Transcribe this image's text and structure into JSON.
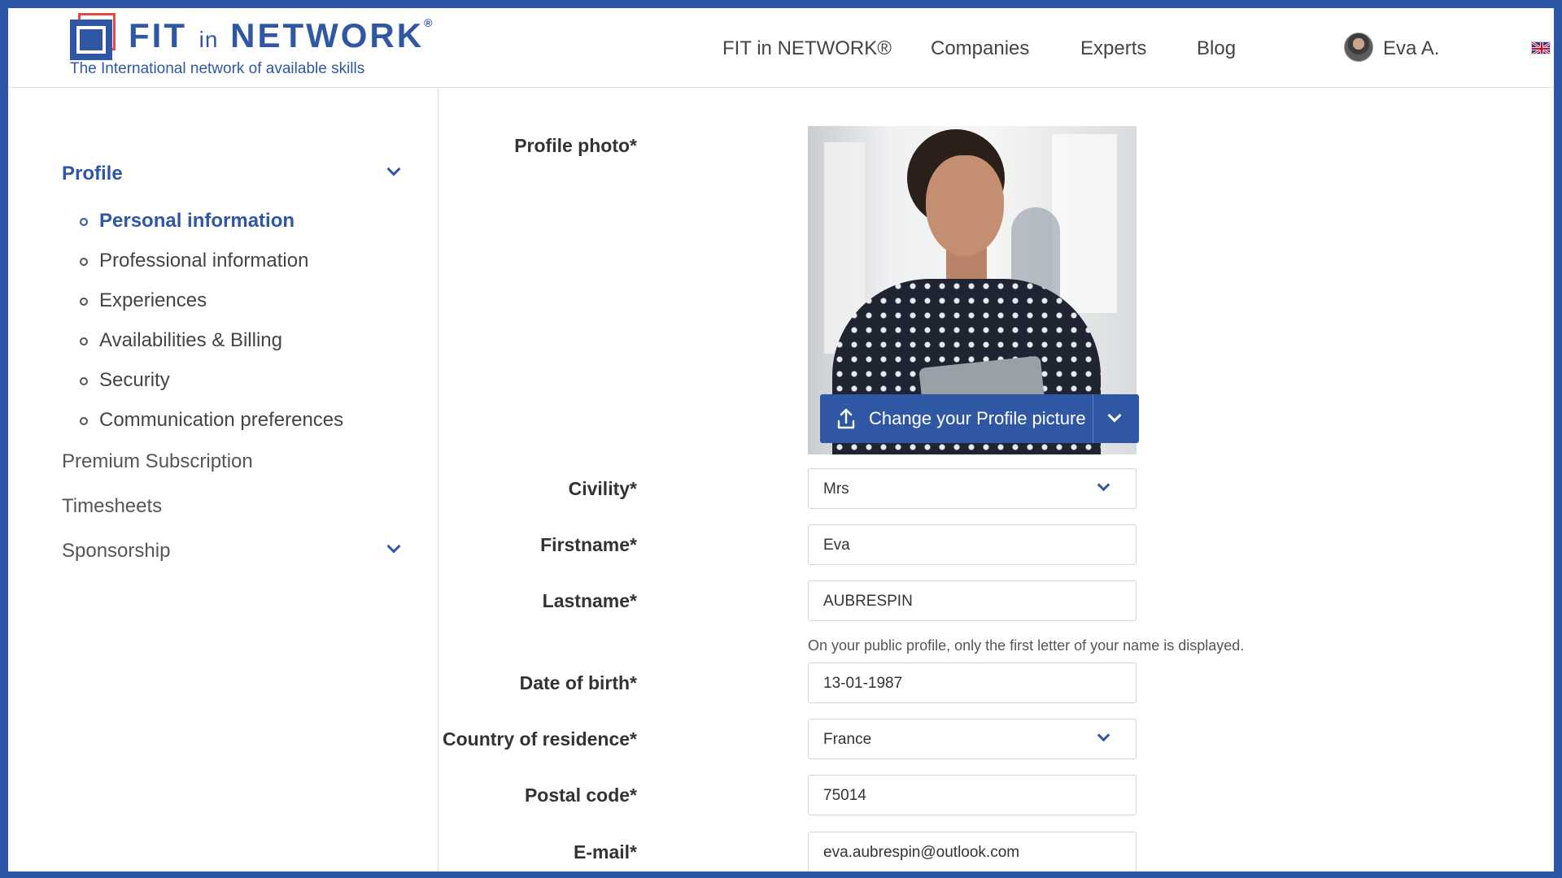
{
  "brand": {
    "logo_word_1": "FIT",
    "logo_word_2": "in",
    "logo_word_3": "NETWORK",
    "logo_registered": "®",
    "tagline": "The International network of available skills",
    "color_primary": "#2f57a4",
    "color_accent": "#e8474b"
  },
  "nav": {
    "items": [
      {
        "label": "FIT in NETWORK®"
      },
      {
        "label": "Companies"
      },
      {
        "label": "Experts"
      },
      {
        "label": "Blog"
      }
    ],
    "user_name": "Eva A.",
    "language_icon": "uk-flag-icon"
  },
  "sidebar": {
    "profile_label": "Profile",
    "profile_items": [
      {
        "label": "Personal information",
        "active": true
      },
      {
        "label": "Professional information"
      },
      {
        "label": "Experiences"
      },
      {
        "label": "Availabilities & Billing"
      },
      {
        "label": "Security"
      },
      {
        "label": "Communication preferences"
      }
    ],
    "premium_label": "Premium Subscription",
    "timesheets_label": "Timesheets",
    "sponsorship_label": "Sponsorship"
  },
  "form": {
    "photo_label": "Profile photo*",
    "change_photo_label": "Change your Profile picture",
    "civility_label": "Civility*",
    "civility_value": "Mrs",
    "firstname_label": "Firstname*",
    "firstname_value": "Eva",
    "lastname_label": "Lastname*",
    "lastname_value": "AUBRESPIN",
    "lastname_hint": "On your public profile, only the first letter of your name is displayed.",
    "dob_label": "Date of birth*",
    "dob_value": "13-01-1987",
    "country_label": "Country of residence*",
    "country_value": "France",
    "postal_label": "Postal code*",
    "postal_value": "75014",
    "email_label": "E-mail*",
    "email_value": "eva.aubrespin@outlook.com"
  }
}
